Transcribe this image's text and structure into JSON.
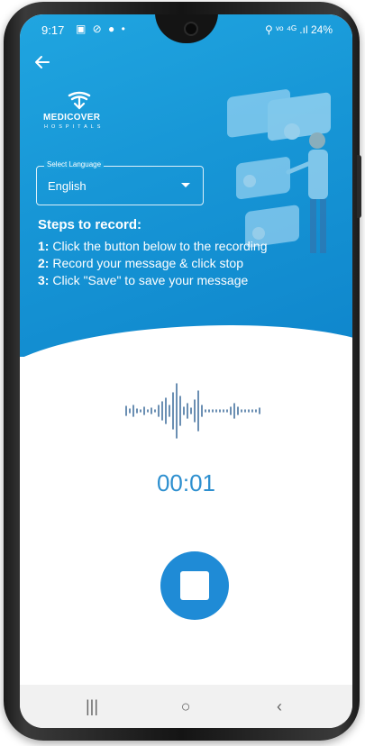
{
  "status_bar": {
    "time": "9:17",
    "left_icons": "▣ ⊘ ● •",
    "right_text": "⚲ ᵛᵒ ⁴ᴳ .ıl 24%"
  },
  "header": {
    "back_icon": "arrow-left-icon",
    "logo": {
      "name": "MEDICOVER",
      "sub": "HOSPITALS"
    }
  },
  "language": {
    "label": "Select Language",
    "value": "English"
  },
  "steps": {
    "title": "Steps to record:",
    "items": [
      {
        "num": "1:",
        "text": " Click the button below to the recording"
      },
      {
        "num": "2:",
        "text": " Record your message & click stop"
      },
      {
        "num": "3:",
        "text": " Click \"Save\" to save your message"
      }
    ]
  },
  "recorder": {
    "timer": "00:01",
    "stop_icon": "stop-icon"
  },
  "nav": {
    "recents": "|||",
    "home": "○",
    "back": "‹"
  },
  "colors": {
    "primary": "#1a9ad8",
    "button": "#1f8bd6",
    "timer": "#2d8fcf"
  }
}
